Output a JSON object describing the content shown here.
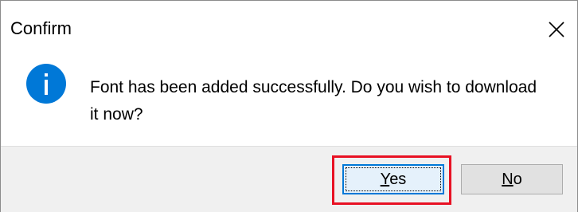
{
  "dialog": {
    "title": "Confirm",
    "close_icon": "close-icon",
    "message": "Font has been added successfully. Do you wish to download it now?",
    "message_icon": "info-icon"
  },
  "buttons": {
    "yes_first": "Y",
    "yes_rest": "es",
    "no_first": "N",
    "no_rest": "o"
  },
  "colors": {
    "info_icon": "#0078d7",
    "focus_border": "#0078d7",
    "highlight": "#e81123",
    "footer_bg": "#f0f0f0"
  }
}
